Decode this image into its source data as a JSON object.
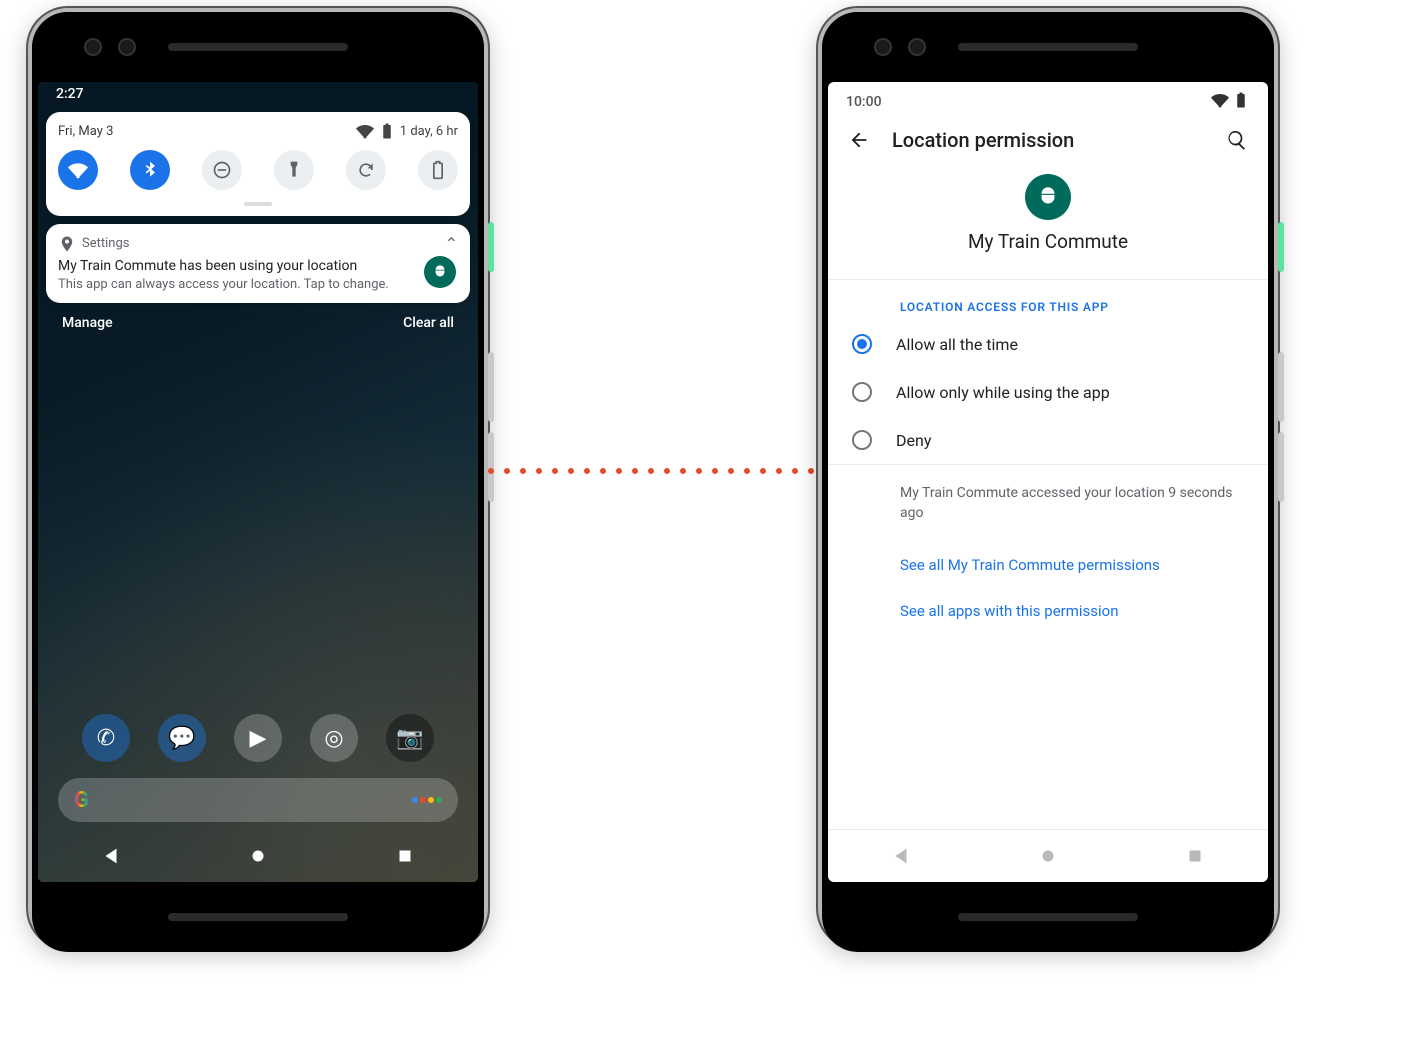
{
  "left": {
    "status": {
      "time": "2:27"
    },
    "qs": {
      "date": "Fri, May 3",
      "battery_label": "1 day, 6 hr",
      "toggles": [
        {
          "name": "wifi",
          "on": true
        },
        {
          "name": "bluetooth",
          "on": true
        },
        {
          "name": "dnd",
          "on": false
        },
        {
          "name": "flashlight",
          "on": false
        },
        {
          "name": "rotate",
          "on": false
        },
        {
          "name": "battery",
          "on": false
        }
      ]
    },
    "notif": {
      "source": "Settings",
      "title": "My Train Commute has been using your location",
      "subtitle": "This app can always access your location. Tap to change."
    },
    "shade_actions": {
      "manage": "Manage",
      "clear": "Clear all"
    }
  },
  "right": {
    "status": {
      "time": "10:00"
    },
    "page_title": "Location permission",
    "app_name": "My Train Commute",
    "section_label": "LOCATION ACCESS FOR THIS APP",
    "options": [
      {
        "label": "Allow all the time",
        "selected": true
      },
      {
        "label": "Allow only while using the app",
        "selected": false
      },
      {
        "label": "Deny",
        "selected": false
      }
    ],
    "info": "My Train Commute accessed your location 9 seconds ago",
    "links": {
      "app_perms": "See all My Train Commute permissions",
      "all_apps": "See all apps with this permission"
    }
  }
}
